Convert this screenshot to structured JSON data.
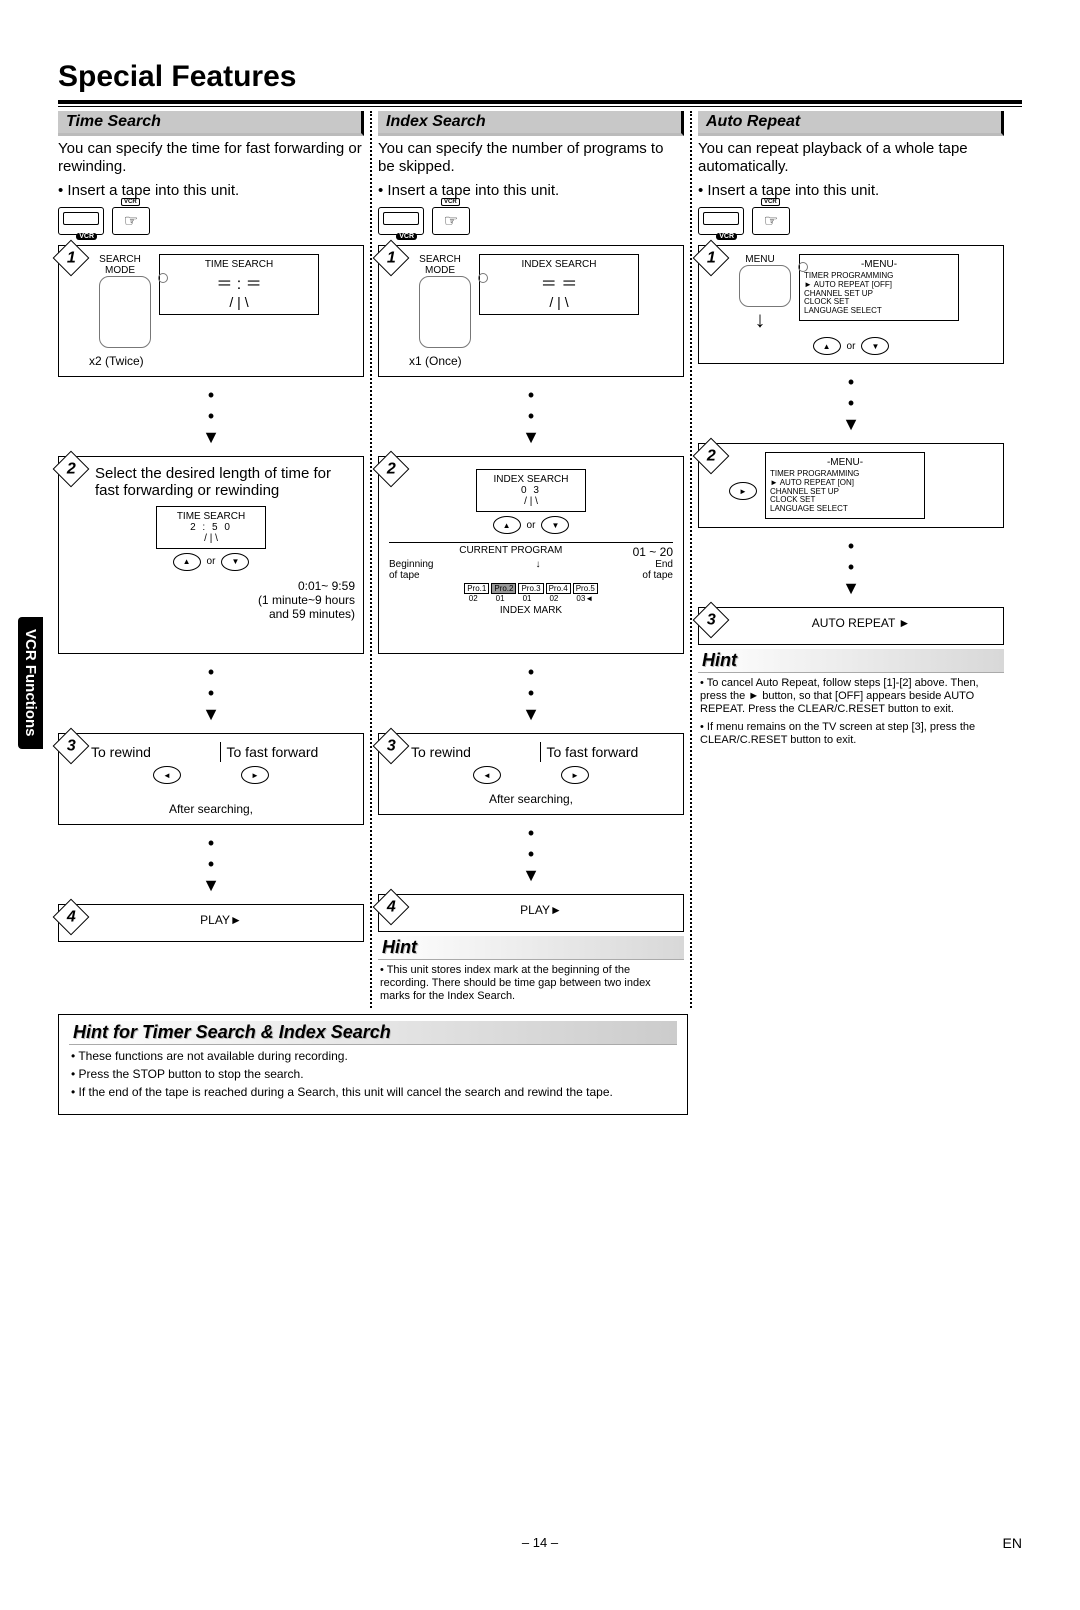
{
  "page_title": "Special Features",
  "side_tab": "VCR Functions",
  "page_num": "– 14 –",
  "lang_code": "EN",
  "time_search": {
    "title": "Time Search",
    "intro": "You can specify the time for fast forwarding or rewinding.",
    "bullet": "• Insert a tape into this unit.",
    "step1_caption_label": "TIME SEARCH",
    "step1_caption_bottom": "x2 (Twice)",
    "step2_text": "Select the desired length of time for fast forwarding or rewinding",
    "step2_screen_label": "TIME SEARCH",
    "step2_screen_value": "2 : 5 0",
    "step2_range": "0:01~ 9:59\n(1 minute~9 hours\nand 59 minutes)",
    "step2_or": "or",
    "step3_left": "To rewind",
    "step3_right": "To fast forward",
    "step3_after": "After searching,",
    "step4_play": "PLAY►",
    "search_mode": "SEARCH\nMODE"
  },
  "index_search": {
    "title": "Index Search",
    "intro": "You can specify the number of programs to be skipped.",
    "bullet": "• Insert a tape into this unit.",
    "step1_caption_label": "INDEX SEARCH",
    "step1_caption_bottom": "x1 (Once)",
    "step2_screen_label": "INDEX SEARCH",
    "step2_screen_value": "0 3",
    "step2_range": "01 ~ 20",
    "step2_or": "or",
    "step2_cp": "CURRENT PROGRAM",
    "step2_begin": "Beginning\nof tape",
    "step2_end": "End\nof tape",
    "step2_index_mark": "INDEX MARK",
    "pro_labels": [
      "Pro.1",
      "Pro.2",
      "Pro.3",
      "Pro.4",
      "Pro.5"
    ],
    "pro_nums": [
      "02",
      "01",
      "01",
      "02",
      "03◄"
    ],
    "step3_left": "To rewind",
    "step3_right": "To fast forward",
    "step3_after": "After searching,",
    "step4_play": "PLAY►",
    "hint_title": "Hint",
    "hint_body": "• This unit stores index mark at the beginning of the recording. There should be time gap between two index marks for the Index Search."
  },
  "auto_repeat": {
    "title": "Auto Repeat",
    "intro": "You can repeat playback of a whole tape automatically.",
    "bullet": "• Insert a tape into this unit.",
    "menu_label": "MENU",
    "screen1_title": "-MENU-",
    "screen1_items": [
      "TIMER PROGRAMMING",
      "► AUTO REPEAT  [OFF]",
      "CHANNEL SET UP",
      "CLOCK SET",
      "LANGUAGE SELECT"
    ],
    "step1_or": "or",
    "screen2_title": "-MENU-",
    "screen2_items": [
      "TIMER PROGRAMMING",
      "► AUTO REPEAT  [ON]",
      "CHANNEL SET UP",
      "CLOCK SET",
      "LANGUAGE SELECT"
    ],
    "step3_label": "AUTO REPEAT ►",
    "hint_title": "Hint",
    "hint_lines": [
      "• To cancel Auto Repeat, follow steps [1]-[2] above. Then, press the ► button, so that [OFF] appears beside AUTO REPEAT.  Press the CLEAR/C.RESET button to exit.",
      "• If menu remains on the TV screen at step [3], press the CLEAR/C.RESET button to exit."
    ]
  },
  "footer_hint": {
    "title": "Hint for Timer Search & Index Search",
    "lines": [
      "• These functions are not available during recording.",
      "• Press the STOP button to stop the search.",
      "• If the end of the tape is reached during a Search, this unit will cancel the search and rewind the tape."
    ]
  }
}
